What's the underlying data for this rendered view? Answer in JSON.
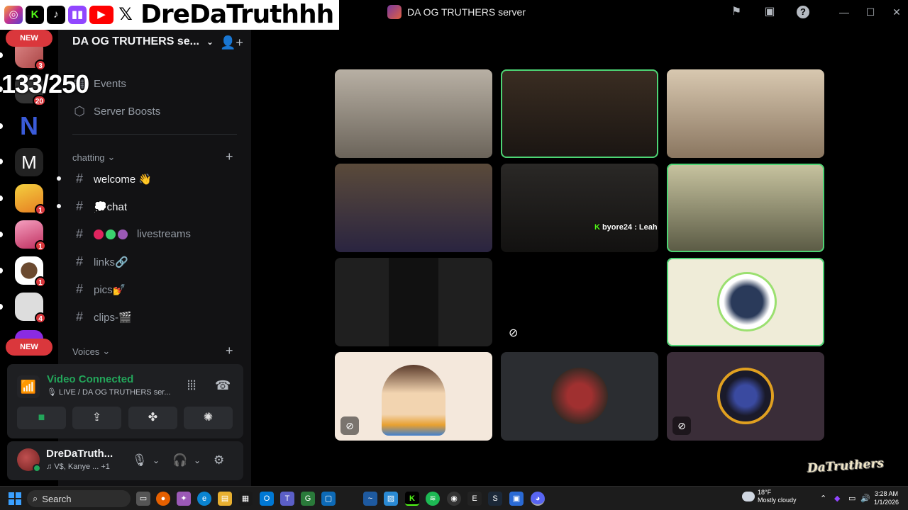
{
  "window": {
    "server_title": "DA OG TRUTHERS server"
  },
  "overlay": {
    "streamer_name": "DreDaTruthhh",
    "viewer_counter": "133/250",
    "socials": [
      "instagram-icon",
      "kick-icon",
      "tiktok-icon",
      "twitch-icon",
      "youtube-icon",
      "x-icon"
    ]
  },
  "rail": {
    "new_top": "NEW",
    "new_bottom": "NEW",
    "servers": [
      {
        "badge": "3"
      },
      {
        "badge": "20"
      },
      {
        "badge": ""
      },
      {
        "badge": ""
      },
      {
        "badge": "1"
      },
      {
        "badge": "1"
      },
      {
        "badge": "1"
      },
      {
        "badge": "4"
      }
    ]
  },
  "sidebar": {
    "server_name": "DA OG TRUTHERS se...",
    "events_label": "Events",
    "boosts_label": "Server Boosts",
    "category_chatting": "chatting",
    "category_voices": "Voices",
    "channels": [
      {
        "name": "welcome 👋",
        "unread": true
      },
      {
        "name": "💭chat",
        "unread": true
      },
      {
        "name": "livestreams",
        "unread": false
      },
      {
        "name": "links🔗",
        "unread": false
      },
      {
        "name": "pics💅",
        "unread": false
      },
      {
        "name": "clips-🎬",
        "unread": false
      }
    ]
  },
  "voice": {
    "status": "Video Connected",
    "channel": "LIVE / DA OG TRUTHERS ser..."
  },
  "user": {
    "name": "DreDaTruth...",
    "activity": "V$, Kanye ...",
    "extra": "+1"
  },
  "stage": {
    "caption_user": "byore24 : Leah"
  },
  "watermark": "DaTruthers",
  "taskbar": {
    "search_label": "Search",
    "weather_temp": "18°F",
    "weather_desc": "Mostly cloudy",
    "time": "3:28 AM",
    "date": "1/1/2026"
  },
  "colors": {
    "speaking": "#4dd474",
    "connected": "#23a55a",
    "badge": "#da373c"
  }
}
